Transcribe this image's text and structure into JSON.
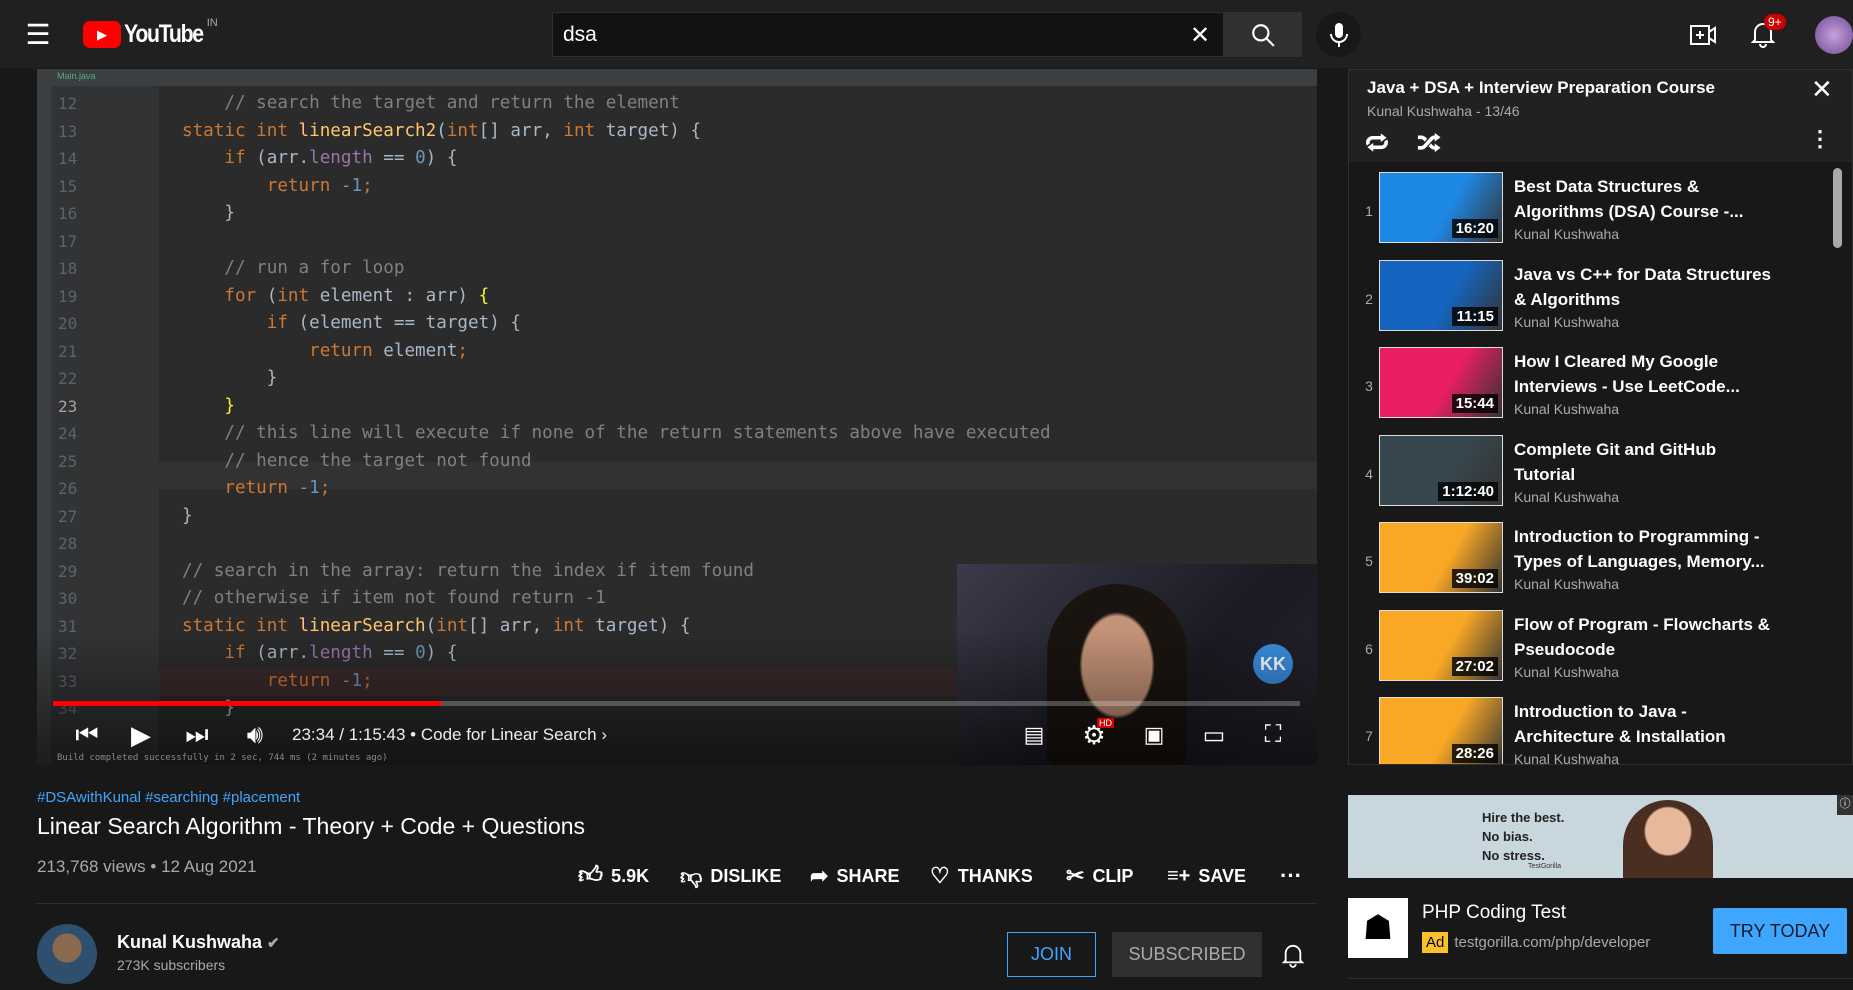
{
  "header": {
    "logo_text": "YouTube",
    "region": "IN",
    "search_value": "dsa",
    "notification_count": "9+"
  },
  "player": {
    "tab": "Main.java",
    "code_lines": [
      {
        "n": "12",
        "t": [
          [
            "    // search the target and return the element",
            "cm"
          ]
        ]
      },
      {
        "n": "13",
        "t": [
          [
            "static int ",
            "kw"
          ],
          [
            "linearSearch2",
            "fn"
          ],
          [
            "(",
            "tx"
          ],
          [
            "int",
            "kw"
          ],
          [
            "[] arr, ",
            "tx"
          ],
          [
            "int ",
            "kw"
          ],
          [
            "target) {",
            "tx"
          ]
        ]
      },
      {
        "n": "14",
        "t": [
          [
            "    if ",
            "kw"
          ],
          [
            "(arr.",
            "tx"
          ],
          [
            "length",
            "fld"
          ],
          [
            " == ",
            "tx"
          ],
          [
            "0",
            "num"
          ],
          [
            ") {",
            "tx"
          ]
        ]
      },
      {
        "n": "15",
        "t": [
          [
            "        return ",
            "kw"
          ],
          [
            "-1",
            "num"
          ],
          [
            ";",
            "kw"
          ]
        ]
      },
      {
        "n": "16",
        "t": [
          [
            "    }",
            "tx"
          ]
        ]
      },
      {
        "n": "17",
        "t": []
      },
      {
        "n": "18",
        "t": [
          [
            "    // run a for loop",
            "cm"
          ]
        ]
      },
      {
        "n": "19",
        "t": [
          [
            "    for ",
            "kw"
          ],
          [
            "(",
            "tx"
          ],
          [
            "int ",
            "kw"
          ],
          [
            "element : arr) ",
            "tx"
          ],
          [
            "{",
            "br"
          ]
        ]
      },
      {
        "n": "20",
        "t": [
          [
            "        if ",
            "kw"
          ],
          [
            "(element == target) {",
            "tx"
          ]
        ]
      },
      {
        "n": "21",
        "t": [
          [
            "            return ",
            "kw"
          ],
          [
            "element",
            "tx"
          ],
          [
            ";",
            "kw"
          ]
        ]
      },
      {
        "n": "22",
        "t": [
          [
            "        }",
            "tx"
          ]
        ]
      },
      {
        "n": "23",
        "t": [
          [
            "    ",
            "tx"
          ],
          [
            "}",
            "br"
          ]
        ]
      },
      {
        "n": "24",
        "t": [
          [
            "    // this line will execute if none of the return statements above have executed",
            "cm"
          ]
        ]
      },
      {
        "n": "25",
        "t": [
          [
            "    // hence the target not found",
            "cm"
          ]
        ]
      },
      {
        "n": "26",
        "t": [
          [
            "    return ",
            "kw"
          ],
          [
            "-1",
            "num"
          ],
          [
            ";",
            "kw"
          ]
        ]
      },
      {
        "n": "27",
        "t": [
          [
            "}",
            "tx"
          ]
        ]
      },
      {
        "n": "28",
        "t": []
      },
      {
        "n": "29",
        "t": [
          [
            "// search in the array: return the index if item found",
            "cm"
          ]
        ]
      },
      {
        "n": "30",
        "t": [
          [
            "// otherwise if item not found return -1",
            "cm"
          ]
        ]
      },
      {
        "n": "31",
        "t": [
          [
            "static int ",
            "kw"
          ],
          [
            "linearSearch",
            "fn"
          ],
          [
            "(",
            "tx"
          ],
          [
            "int",
            "kw"
          ],
          [
            "[] arr, ",
            "tx"
          ],
          [
            "int ",
            "kw"
          ],
          [
            "target) {",
            "tx"
          ]
        ]
      },
      {
        "n": "32",
        "t": [
          [
            "    if ",
            "kw"
          ],
          [
            "(arr.",
            "tx"
          ],
          [
            "length",
            "fld"
          ],
          [
            " == ",
            "tx"
          ],
          [
            "0",
            "num"
          ],
          [
            ") {",
            "tx"
          ]
        ]
      },
      {
        "n": "33",
        "t": [
          [
            "        return ",
            "kw"
          ],
          [
            "-1",
            "num"
          ],
          [
            ";",
            "kw"
          ]
        ]
      },
      {
        "n": "34",
        "t": [
          [
            "    }",
            "tx"
          ]
        ]
      }
    ],
    "build_status": "Build completed successfully in 2 sec, 744 ms (2 minutes ago)",
    "current_time": "23:34 / 1:15:43",
    "chapter": "Code for Linear Search",
    "progress_percent": 31.1,
    "hd_badge": "HD",
    "watermark": "KK"
  },
  "video": {
    "hashtags": "#DSAwithKunal #searching #placement",
    "title": "Linear Search Algorithm - Theory + Code + Questions",
    "stats": "213,768 views • 12 Aug 2021",
    "actions": {
      "like": "5.9K",
      "dislike": "DISLIKE",
      "share": "SHARE",
      "thanks": "THANKS",
      "clip": "CLIP",
      "save": "SAVE"
    }
  },
  "channel": {
    "name": "Kunal Kushwaha",
    "subscribers": "273K subscribers",
    "join": "JOIN",
    "subscribed": "SUBSCRIBED"
  },
  "playlist": {
    "title": "Java + DSA + Interview Preparation Course",
    "meta": "Kunal Kushwaha - 13/46",
    "items": [
      {
        "index": "1",
        "title": "Best Data Structures & Algorithms (DSA) Course -...",
        "channel": "Kunal Kushwaha",
        "duration": "16:20",
        "color": "#1e88e5"
      },
      {
        "index": "2",
        "title": "Java vs C++ for Data Structures & Algorithms",
        "channel": "Kunal Kushwaha",
        "duration": "11:15",
        "color": "#1565c0"
      },
      {
        "index": "3",
        "title": "How I Cleared My Google Interviews - Use LeetCode...",
        "channel": "Kunal Kushwaha",
        "duration": "15:44",
        "color": "#e91e63"
      },
      {
        "index": "4",
        "title": "Complete Git and GitHub Tutorial",
        "channel": "Kunal Kushwaha",
        "duration": "1:12:40",
        "color": "#37474f"
      },
      {
        "index": "5",
        "title": "Introduction to Programming - Types of Languages, Memory...",
        "channel": "Kunal Kushwaha",
        "duration": "39:02",
        "color": "#f9a825"
      },
      {
        "index": "6",
        "title": "Flow of Program - Flowcharts & Pseudocode",
        "channel": "Kunal Kushwaha",
        "duration": "27:02",
        "color": "#f9a825"
      },
      {
        "index": "7",
        "title": "Introduction to Java - Architecture & Installation",
        "channel": "Kunal Kushwaha",
        "duration": "28:26",
        "color": "#f9a825"
      }
    ]
  },
  "ad": {
    "banner_lines": [
      "Hire the best.",
      "No bias.",
      "No stress."
    ],
    "banner_brand": "TestGorilla",
    "title": "PHP Coding Test",
    "badge": "Ad",
    "url": "testgorilla.com/php/developer",
    "cta": "TRY TODAY"
  },
  "colors": {
    "accent": "#3ea6ff",
    "progress": "#ff0000",
    "ad_badge": "#fbc02d"
  }
}
